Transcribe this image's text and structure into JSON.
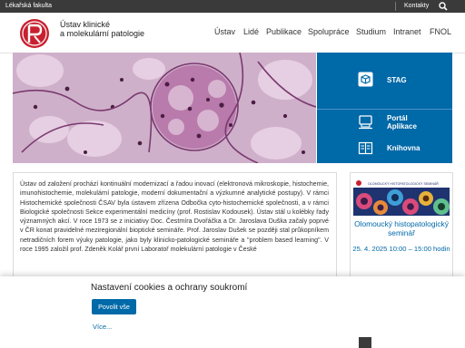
{
  "topbar": {
    "faculty": "Lékařská fakulta",
    "contacts": "Kontakty"
  },
  "header": {
    "title_line1": "Ústav klinické",
    "title_line2": "a molekulární patologie"
  },
  "nav": [
    "Ústav",
    "Lidé",
    "Publikace",
    "Spolupráce",
    "Studium",
    "Intranet",
    "FNOL"
  ],
  "quicklinks": [
    {
      "label": "STAG",
      "icon": "stag-box-icon"
    },
    {
      "label": "Portál",
      "label2": "Aplikace",
      "icon": "portal-apps-icon"
    },
    {
      "label": "Knihovna",
      "icon": "library-icon"
    }
  ],
  "main": {
    "text": "Ústav od založení prochází kontinuální modernizací a řadou inovací (elektronová mikroskopie, histochemie, imunohistochemie, molekulární patologie, moderní dokumentační a výzkumné analytické postupy). V rámci Histochemické společnosti ČSAV byla ústavem zřízena Odbočka cyto-histochemické společnosti, a v rámci Biologické společnosti Sekce experimentální medicíny (prof. Rostislav Kodousek). Ústav stál u kolébky řady významných akcí. V roce 1973 se z iniciativy Doc. Čestmíra Dvořáčka a Dr. Jaroslava Duška začaly poprvé v ČR konat pravidelné meziregionální bioptické semináře. Prof. Jaroslav Dušek se později stal průkopníkem netradičních forem výuky patologie, jako byly klinicko-patologické semináře a \"problem based learning\". V roce 1995 založil prof. Zdeněk Kolář první Laboratoř molekulární patologie v České"
  },
  "event": {
    "title": "Olomoucký histopatologický seminář",
    "date": "25. 4. 2025 10:00 – 15:00 hodin",
    "image_caption": "OLOMOUCKÝ HISTOPATOLOGICKÝ SEMINÁŘ"
  },
  "cookie": {
    "title": "Nastavení cookies a ochrany soukromí",
    "accept": "Povolit vše",
    "more": "Více..."
  },
  "colors": {
    "accent": "#0069a8",
    "logo_red": "#c8202f",
    "topbar": "#3a3a3a"
  }
}
